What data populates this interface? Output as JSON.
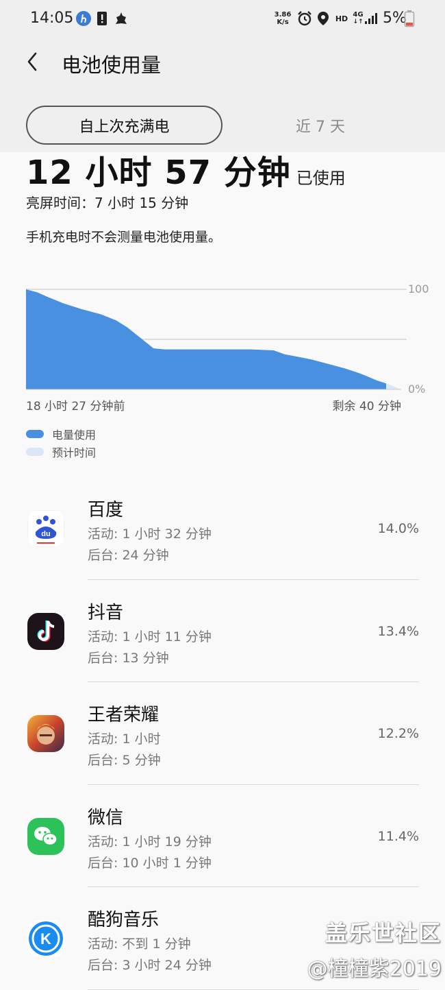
{
  "status_bar": {
    "time": "14:05",
    "net_speed_value": "3.86",
    "net_speed_unit": "K/s",
    "hd_label": "HD",
    "network_type": "4G",
    "battery_percent": "5%",
    "icons": [
      "app-notification-icon",
      "alert-icon",
      "shell-icon",
      "alarm-icon",
      "location-icon",
      "signal-icon",
      "battery-icon"
    ]
  },
  "header": {
    "title": "电池使用量",
    "back_icon": "back-chevron-icon"
  },
  "tabs": {
    "selected": "自上次充满电",
    "other": "近 7 天"
  },
  "summary": {
    "usage_time": "12 小时 57 分钟",
    "usage_suffix": "已使用",
    "screen_time": "亮屏时间：7 小时 15 分钟",
    "note": "手机充电时不会测量电池使用量。"
  },
  "chart_data": {
    "type": "area",
    "y_max_label": "100",
    "y_min_label": "0%",
    "x_start_label": "18 小时 27 分钟前",
    "x_end_label": "剩余 40 分钟",
    "ylim": [
      0,
      100
    ],
    "series": [
      {
        "name": "电量使用",
        "color": "#4a90e0",
        "x": [
          0,
          0.03,
          0.06,
          0.1,
          0.15,
          0.2,
          0.24,
          0.27,
          0.3,
          0.34,
          0.37,
          0.42,
          0.6,
          0.66,
          0.69,
          0.72,
          0.76,
          0.8,
          0.85,
          0.89,
          0.91,
          0.935,
          0.96
        ],
        "values": [
          100,
          97,
          92,
          86,
          80,
          75,
          69,
          62,
          53,
          41,
          40,
          40,
          40,
          39,
          35,
          33,
          30,
          26,
          21,
          16,
          13,
          9,
          6
        ]
      },
      {
        "name": "预计时间",
        "color": "#dbe7f6",
        "x": [
          0.96,
          0.98,
          1.0
        ],
        "values": [
          6,
          3,
          0
        ]
      }
    ],
    "legend": [
      "电量使用",
      "预计时间"
    ],
    "grid": true
  },
  "apps": [
    {
      "name": "百度",
      "active": "活动: 1 小时 32 分钟",
      "background": "后台: 24 分钟",
      "percent": "14.0%",
      "icon": "baidu-icon"
    },
    {
      "name": "抖音",
      "active": "活动: 1 小时 11 分钟",
      "background": "后台: 13 分钟",
      "percent": "13.4%",
      "icon": "douyin-icon"
    },
    {
      "name": "王者荣耀",
      "active": "活动: 1 小时",
      "background": "后台: 5 分钟",
      "percent": "12.2%",
      "icon": "honor-of-kings-icon"
    },
    {
      "name": "微信",
      "active": "活动: 1 小时 19 分钟",
      "background": "后台: 10 小时 1 分钟",
      "percent": "11.4%",
      "icon": "wechat-icon"
    },
    {
      "name": "酷狗音乐",
      "active": "活动: 不到 1 分钟",
      "background": "后台: 3 小时 24 分钟",
      "percent": "",
      "icon": "kugou-icon"
    }
  ],
  "watermark": {
    "line1": "盖乐世社区",
    "line2": "@橦橦紫2019"
  }
}
